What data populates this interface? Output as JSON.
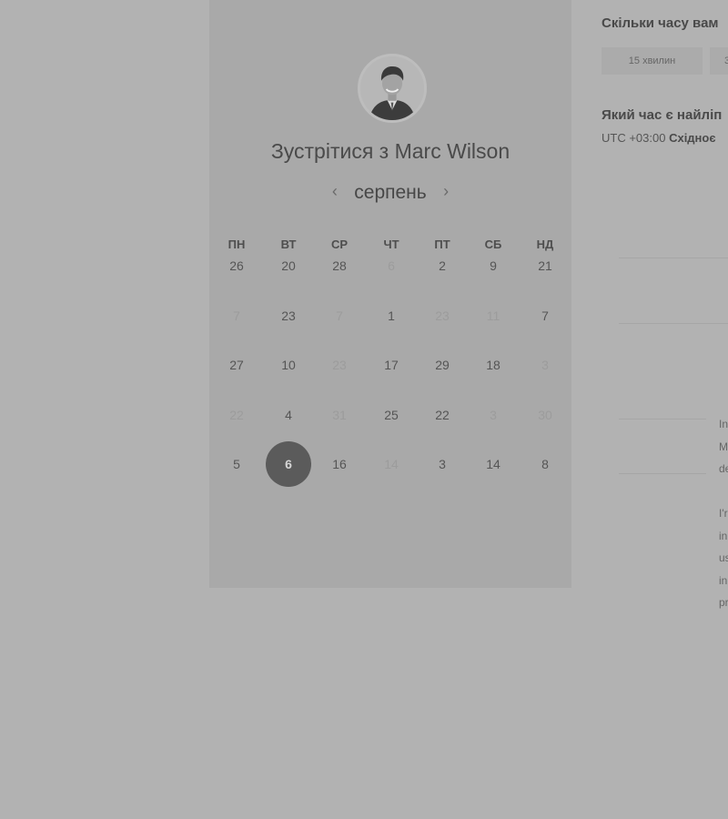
{
  "calendar": {
    "title": "Зустрітися з Marc Wilson",
    "month": "серпень",
    "prev_icon": "chevron-left-icon",
    "next_icon": "chevron-right-icon",
    "weekdays": [
      "ПН",
      "ВТ",
      "СР",
      "ЧТ",
      "ПТ",
      "СБ",
      "НД"
    ],
    "weeks": [
      [
        {
          "d": "26",
          "m": false
        },
        {
          "d": "20",
          "m": false
        },
        {
          "d": "28",
          "m": false
        },
        {
          "d": "6",
          "m": true
        },
        {
          "d": "2",
          "m": false
        },
        {
          "d": "9",
          "m": false
        },
        {
          "d": "21",
          "m": false
        }
      ],
      [
        {
          "d": "7",
          "m": true
        },
        {
          "d": "23",
          "m": false
        },
        {
          "d": "7",
          "m": true
        },
        {
          "d": "1",
          "m": false
        },
        {
          "d": "23",
          "m": true
        },
        {
          "d": "11",
          "m": true
        },
        {
          "d": "7",
          "m": false
        }
      ],
      [
        {
          "d": "27",
          "m": false
        },
        {
          "d": "10",
          "m": false
        },
        {
          "d": "23",
          "m": true
        },
        {
          "d": "17",
          "m": false
        },
        {
          "d": "29",
          "m": false
        },
        {
          "d": "18",
          "m": false
        },
        {
          "d": "3",
          "m": true
        }
      ],
      [
        {
          "d": "22",
          "m": true
        },
        {
          "d": "4",
          "m": false
        },
        {
          "d": "31",
          "m": true
        },
        {
          "d": "25",
          "m": false
        },
        {
          "d": "22",
          "m": false
        },
        {
          "d": "3",
          "m": true
        },
        {
          "d": "30",
          "m": true
        }
      ],
      [
        {
          "d": "5",
          "m": false
        },
        {
          "d": "6",
          "m": false,
          "sel": true
        },
        {
          "d": "16",
          "m": false
        },
        {
          "d": "14",
          "m": true
        },
        {
          "d": "3",
          "m": false
        },
        {
          "d": "14",
          "m": false
        },
        {
          "d": "8",
          "m": false
        }
      ]
    ]
  },
  "booking": {
    "duration_question": "Скільки часу вам",
    "durations": [
      "15 хвилин",
      "3"
    ],
    "time_question": "Який час є найліп",
    "timezone_offset": "UTC +03:00",
    "timezone_name": "Східноє"
  },
  "description": {
    "p1": [
      "In",
      "M",
      "de"
    ],
    "p2": [
      "I'r",
      "in",
      "us",
      "in",
      "pr"
    ]
  }
}
